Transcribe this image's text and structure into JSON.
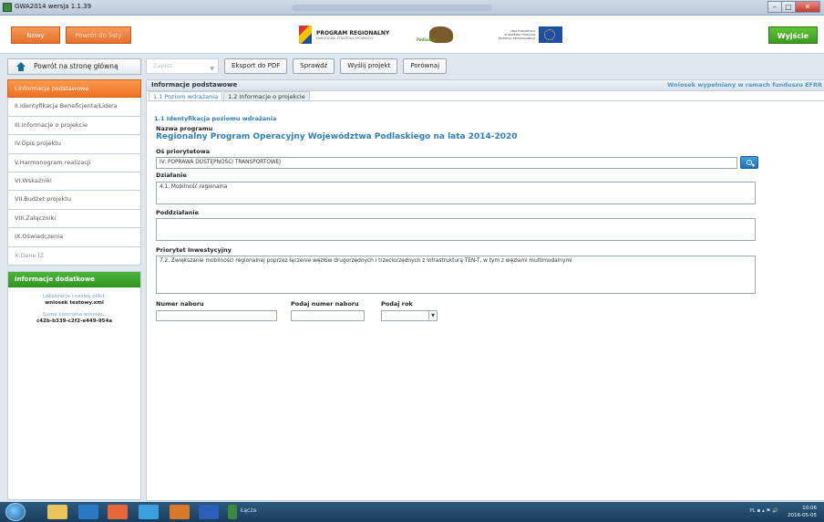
{
  "window": {
    "title": "GWA2014 wersja 1.1.39"
  },
  "header": {
    "new_label": "Nowy",
    "back_to_list_label": "Powrót do listy",
    "exit_label": "Wyjście",
    "logo_program": "PROGRAM REGIONALNY",
    "logo_program_sub": "NARODOWA STRATEGIA SPÓJNOŚCI",
    "logo_region": "Podlaskie",
    "logo_eu": "UNIA EUROPEJSKA EUROPEJSKI FUNDUSZ ROZWOJU REGIONALNEGO"
  },
  "sidebar": {
    "home_label": "Powrót na stronę główną",
    "items": [
      {
        "label": "I.Informacje podstawowe"
      },
      {
        "label": "II.Identyfikacja Beneficjenta/Lidera"
      },
      {
        "label": "III.Informacje o projekcie"
      },
      {
        "label": "IV.Opis projektu"
      },
      {
        "label": "V.Harmonogram realizacji"
      },
      {
        "label": "VI.Wskaźniki"
      },
      {
        "label": "VII.Budżet projektu"
      },
      {
        "label": "VIII.Załączniki"
      },
      {
        "label": "IX.Oświadczenia"
      },
      {
        "label": "X.Dane IZ"
      }
    ],
    "info": {
      "title": "Informacje dodatkowe",
      "file_label": "Lokalizacja i nazwa pliku:",
      "file_value": "wniosek testowy.xml",
      "checksum_label": "Suma kontrolna wniosku:",
      "checksum_value": "c42b-b339-c2f2-e449-954a"
    }
  },
  "toolbar": {
    "save_label": "Zapisz",
    "export_pdf_label": "Eksport do PDF",
    "check_label": "Sprawdź",
    "send_label": "Wyślij projekt",
    "compare_label": "Porównaj"
  },
  "main": {
    "title": "Informacje podstawowe",
    "fund_notice": "Wniosek wypełniany w ramach funduszu EFRR",
    "tabs": [
      {
        "label": "1.1 Poziom wdrażania"
      },
      {
        "label": "1.2 Informacje o projekcie"
      }
    ],
    "section_title": "1.1 Identyfikacja poziomu wdrażania",
    "program_label": "Nazwa programu",
    "program_value": "Regionalny Program Operacyjny Województwa Podlaskiego na lata 2014-2020",
    "axis_label": "Oś priorytetowa",
    "axis_value": "IV: POPRAWA DOSTĘPNOŚCI TRANSPORTOWEJ",
    "action_label": "Działanie",
    "action_value": "4.1. Mobilność regionalna",
    "subaction_label": "Poddziałanie",
    "subaction_value": "",
    "investment_label": "Priorytet Inwestycyjny",
    "investment_value": "7.2. Zwiększanie mobilności regionalnej poprzez łączenie węzłów drugorzędnych i trzeciorzędnych z infrastrukturą TEN-T, w tym z węzłami multimodalnymi",
    "call_number_label": "Numer naboru",
    "call_number_value": "",
    "enter_call_label": "Podaj numer naboru",
    "enter_call_value": "",
    "year_label": "Podaj rok",
    "year_value": ""
  },
  "taskbar": {
    "label": "Łącza",
    "lang": "PL",
    "time": "10:06",
    "date": "2016-05-05"
  }
}
